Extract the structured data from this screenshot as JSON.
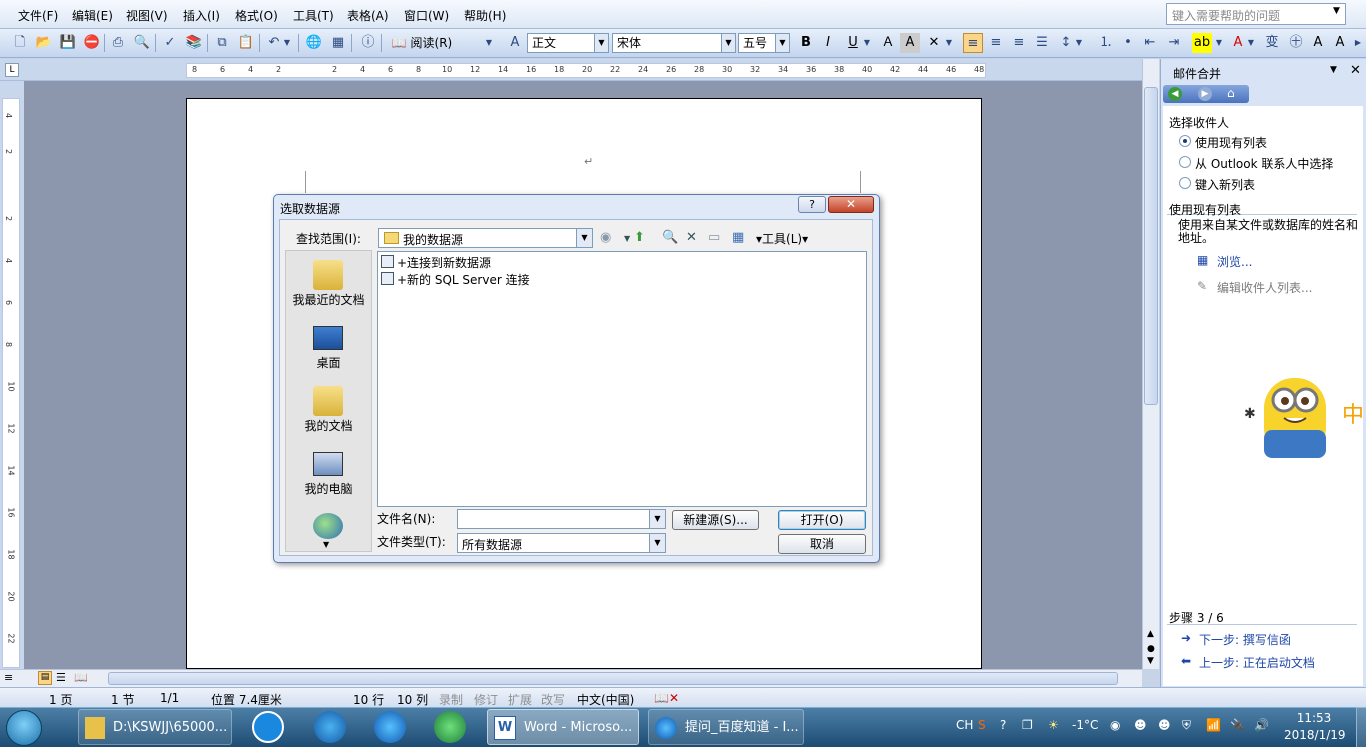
{
  "menu": {
    "items": [
      "文件(F)",
      "编辑(E)",
      "视图(V)",
      "插入(I)",
      "格式(O)",
      "工具(T)",
      "表格(A)",
      "窗口(W)",
      "帮助(H)"
    ],
    "help_placeholder": "键入需要帮助的问题"
  },
  "toolbar": {
    "read_label": "阅读(R)",
    "style_value": "正文",
    "font_value": "宋体",
    "size_value": "五号"
  },
  "ruler": {
    "numbers": [
      "8",
      "6",
      "4",
      "2",
      "2",
      "4",
      "6",
      "8",
      "10",
      "12",
      "14",
      "16",
      "18",
      "20",
      "22",
      "24",
      "26",
      "28",
      "30",
      "32",
      "34",
      "36",
      "38",
      "40",
      "42",
      "44",
      "46",
      "48"
    ],
    "vnumbers": [
      "4",
      "2",
      "2",
      "4",
      "6",
      "8",
      "10",
      "12",
      "14",
      "16",
      "18",
      "20",
      "22"
    ]
  },
  "dialog": {
    "title": "选取数据源",
    "help_label": "?",
    "close_label": "✕",
    "lookin_label": "查找范围(I):",
    "lookin_value": "我的数据源",
    "tools_label": "工具(L)",
    "places": [
      "我最近的文档",
      "桌面",
      "我的文档",
      "我的电脑"
    ],
    "files": [
      "+连接到新数据源",
      "+新的 SQL Server 连接"
    ],
    "filename_label": "文件名(N):",
    "filename_value": "",
    "filetype_label": "文件类型(T):",
    "filetype_value": "所有数据源",
    "newsource_label": "新建源(S)...",
    "open_label": "打开(O)",
    "cancel_label": "取消"
  },
  "taskpane": {
    "title": "邮件合并",
    "section1": "选择收件人",
    "radio": [
      "使用现有列表",
      "从 Outlook 联系人中选择",
      "键入新列表"
    ],
    "radio_selected": 0,
    "section2": "使用现有列表",
    "desc": "使用来自某文件或数据库的姓名和地址。",
    "browse": "浏览...",
    "edit": "编辑收件人列表...",
    "step": "步骤 3 / 6",
    "next": "下一步: 撰写信函",
    "prev": "上一步: 正在启动文档"
  },
  "statusbar": {
    "page": "1 页",
    "section": "1 节",
    "pages": "1/1",
    "position": "位置 7.4厘米",
    "line": "10 行",
    "col": "10 列",
    "modes": [
      "录制",
      "修订",
      "扩展",
      "改写"
    ],
    "lang": "中文(中国)"
  },
  "taskbar": {
    "tasks": [
      "D:\\KSWJJ\\65000...",
      "Word - Microso...",
      "提问_百度知道 - I..."
    ],
    "lang": "CH",
    "temp": "-1°C",
    "time": "11:53",
    "date": "2018/1/19"
  },
  "colors": {
    "accent": "#1d47a7",
    "close_red": "#c4432a",
    "doc_bg": "#8c97ad"
  }
}
